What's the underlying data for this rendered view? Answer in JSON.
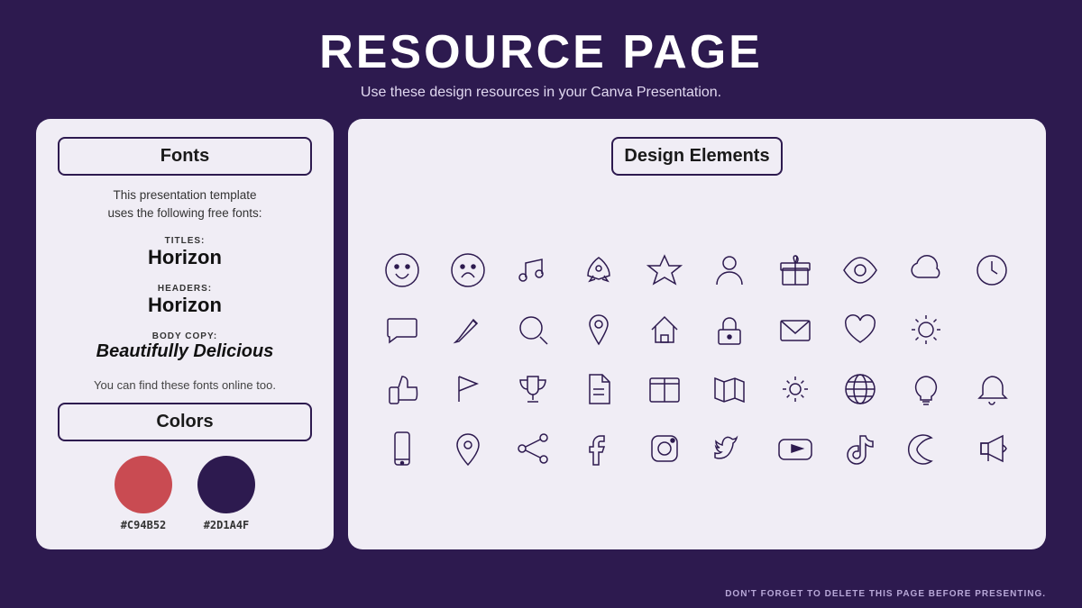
{
  "header": {
    "title": "RESOURCE PAGE",
    "subtitle": "Use these design resources in your Canva Presentation."
  },
  "left_panel": {
    "fonts_label": "Fonts",
    "fonts_desc_line1": "This presentation template",
    "fonts_desc_line2": "uses the following free fonts:",
    "titles_label": "TITLES:",
    "titles_value": "Horizon",
    "headers_label": "HEADERS:",
    "headers_value": "Horizon",
    "body_label": "BODY COPY:",
    "body_value": "Beautifully Delicious",
    "fonts_note": "You can find these fonts online too.",
    "colors_label": "Colors",
    "color1_hex": "#C94B52",
    "color2_hex": "#2D1A4F"
  },
  "right_panel": {
    "design_elements_label": "Design Elements"
  },
  "footer": {
    "note": "DON'T FORGET TO DELETE THIS PAGE BEFORE PRESENTING."
  }
}
